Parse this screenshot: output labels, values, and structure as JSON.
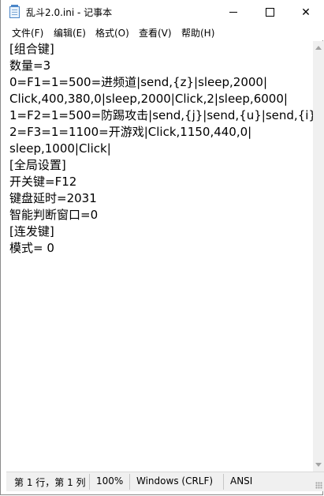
{
  "window": {
    "title": "乱斗2.0.ini - 记事本",
    "icon": "notepad-icon",
    "controls": [
      "minimize-icon",
      "maximize-icon",
      "close-icon"
    ],
    "close_glyph": "✕"
  },
  "menu": {
    "items": [
      {
        "label": "文件(F)"
      },
      {
        "label": "编辑(E)"
      },
      {
        "label": "格式(O)"
      },
      {
        "label": "查看(V)"
      },
      {
        "label": "帮助(H)"
      }
    ]
  },
  "editor": {
    "lines": [
      "[组合键]",
      "数量=3",
      "0=F1=1=500=进频道|send,{z}|sleep,2000|",
      "Click,400,380,0|sleep,2000|Click,2|sleep,6000|",
      "1=F2=1=500=防踢攻击|send,{j}|send,{u}|send,{i}|",
      "2=F3=1=1100=开游戏|Click,1150,440,0|",
      "sleep,1000|Click|",
      "[全局设置]",
      "开关键=F12",
      "键盘延时=2031",
      "智能判断窗口=0",
      "[连发键]",
      "模式= 0"
    ]
  },
  "statusbar": {
    "position": "第 1 行，第 1 列",
    "zoom": "100%",
    "line_ending": "Windows (CRLF)",
    "encoding": "ANSI"
  }
}
